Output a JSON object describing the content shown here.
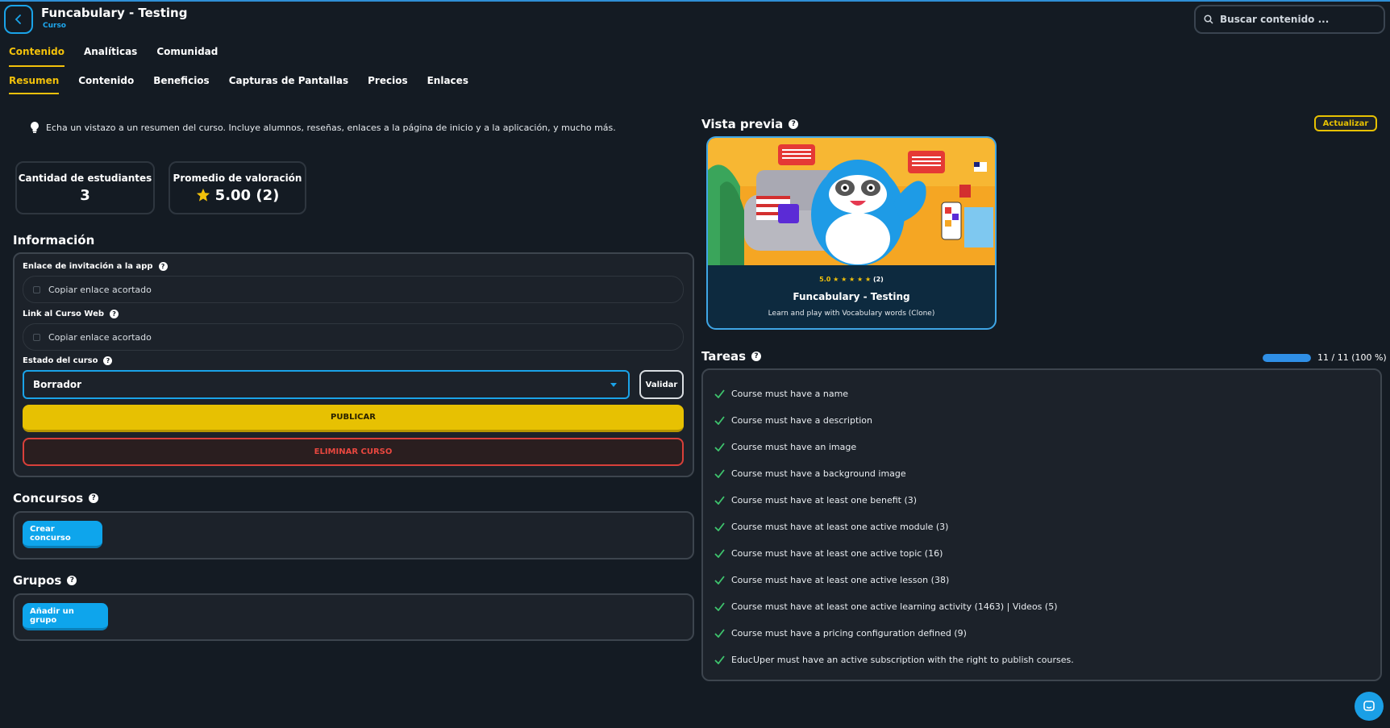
{
  "header": {
    "title": "Funcabulary - Testing",
    "subtitle": "Curso",
    "search_placeholder": "Buscar contenido ..."
  },
  "main_tabs": [
    {
      "label": "Contenido",
      "active": true
    },
    {
      "label": "Analíticas",
      "active": false
    },
    {
      "label": "Comunidad",
      "active": false
    }
  ],
  "sub_tabs": [
    {
      "label": "Resumen",
      "active": true
    },
    {
      "label": "Contenido",
      "active": false
    },
    {
      "label": "Beneficios",
      "active": false
    },
    {
      "label": "Capturas de Pantallas",
      "active": false
    },
    {
      "label": "Precios",
      "active": false
    },
    {
      "label": "Enlaces",
      "active": false
    }
  ],
  "hint": "Echa un vistazo a un resumen del curso. Incluye alumnos, reseñas, enlaces a la página de inicio y a la aplicación, y mucho más.",
  "stats": {
    "students_label": "Cantidad de estudiantes",
    "students_value": "3",
    "rating_label": "Promedio de valoración",
    "rating_value": "5.00 (2)"
  },
  "info": {
    "title": "Información",
    "app_link_label": "Enlace de invitación a la app",
    "app_link_copy": "Copiar enlace acortado",
    "web_link_label": "Link al Curso Web",
    "web_link_copy": "Copiar enlace acortado",
    "status_label": "Estado del curso",
    "status_value": "Borrador",
    "validate_label": "Validar",
    "publish_label": "PUBLICAR",
    "delete_label": "ELIMINAR CURSO"
  },
  "contests": {
    "title": "Concursos",
    "button": "Crear concurso"
  },
  "groups": {
    "title": "Grupos",
    "button": "Añadir un grupo"
  },
  "preview": {
    "title": "Vista previa",
    "update_label": "Actualizar",
    "rating": "5.0",
    "rating_count": "(2)",
    "course_title": "Funcabulary - Testing",
    "course_desc": "Learn and play with Vocabulary words (Clone)"
  },
  "tasks": {
    "title": "Tareas",
    "progress_text": "11 / 11 (100 %)",
    "progress_fraction": 1.0,
    "items": [
      "Course must have a name",
      "Course must have a description",
      "Course must have an image",
      "Course must have a background image",
      "Course must have at least one benefit (3)",
      "Course must have at least one active module (3)",
      "Course must have at least one active topic (16)",
      "Course must have at least one active lesson (38)",
      "Course must have at least one active learning activity (1463) | Videos (5)",
      "Course must have a pricing configuration defined (9)",
      "EducUper must have an active subscription with the right to publish courses."
    ]
  },
  "colors": {
    "accent_yellow": "#f2c10b",
    "accent_blue": "#1aa3e8",
    "danger_red": "#e8473f",
    "success_green": "#3ec46d",
    "background": "#141b23"
  }
}
